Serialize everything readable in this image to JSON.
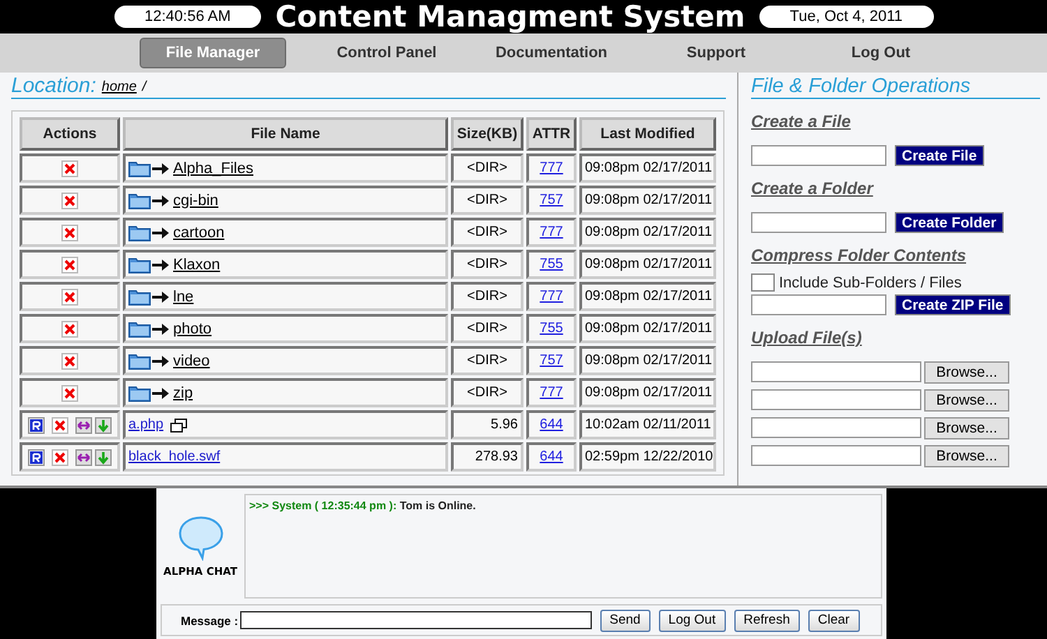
{
  "header": {
    "clock": "12:40:56 AM",
    "title": "Content Managment System",
    "date": "Tue, Oct 4, 2011"
  },
  "nav": [
    {
      "label": "File Manager",
      "selected": true
    },
    {
      "label": "Control Panel",
      "selected": false
    },
    {
      "label": "Documentation",
      "selected": false
    },
    {
      "label": "Support",
      "selected": false
    },
    {
      "label": "Log Out",
      "selected": false
    }
  ],
  "location": {
    "label": "Location:",
    "path": "home",
    "separator": "/"
  },
  "table": {
    "columns": [
      "Actions",
      "File Name",
      "Size(KB)",
      "ATTR",
      "Last Modified"
    ],
    "rows": [
      {
        "kind": "dir",
        "name": "Alpha_Files",
        "size": "<DIR>",
        "attr": "777",
        "modified": "09:08pm 02/17/2011"
      },
      {
        "kind": "dir",
        "name": "cgi-bin",
        "size": "<DIR>",
        "attr": "757",
        "modified": "09:08pm 02/17/2011"
      },
      {
        "kind": "dir",
        "name": "cartoon",
        "size": "<DIR>",
        "attr": "777",
        "modified": "09:08pm 02/17/2011"
      },
      {
        "kind": "dir",
        "name": "Klaxon",
        "size": "<DIR>",
        "attr": "755",
        "modified": "09:08pm 02/17/2011"
      },
      {
        "kind": "dir",
        "name": "lne",
        "size": "<DIR>",
        "attr": "777",
        "modified": "09:08pm 02/17/2011"
      },
      {
        "kind": "dir",
        "name": "photo",
        "size": "<DIR>",
        "attr": "755",
        "modified": "09:08pm 02/17/2011"
      },
      {
        "kind": "dir",
        "name": "video",
        "size": "<DIR>",
        "attr": "757",
        "modified": "09:08pm 02/17/2011"
      },
      {
        "kind": "dir",
        "name": "zip",
        "size": "<DIR>",
        "attr": "777",
        "modified": "09:08pm 02/17/2011"
      },
      {
        "kind": "file",
        "name": "a.php",
        "popup": true,
        "size": "5.96",
        "attr": "644",
        "modified": "10:02am 02/11/2011"
      },
      {
        "kind": "file",
        "name": "black_hole.swf",
        "popup": false,
        "size": "278.93",
        "attr": "644",
        "modified": "02:59pm 12/22/2010"
      }
    ]
  },
  "operations": {
    "title": "File & Folder Operations",
    "create_file": {
      "heading": "Create a File",
      "button": "Create File"
    },
    "create_folder": {
      "heading": "Create a Folder",
      "button": "Create Folder"
    },
    "compress": {
      "heading": "Compress Folder Contents",
      "checkbox_label": "Include Sub-Folders / Files",
      "checked": false,
      "button": "Create ZIP File"
    },
    "upload": {
      "heading": "Upload File(s)",
      "browse_buttons": [
        "Browse...",
        "Browse...",
        "Browse...",
        "Browse..."
      ]
    }
  },
  "chat": {
    "logo": "ALPHA CHAT",
    "messages": [
      {
        "prefix": ">>> System ( 12:35:44 pm ):",
        "text": "Tom is Online."
      }
    ],
    "message_label": "Message :",
    "buttons": [
      "Send",
      "Log Out",
      "Refresh",
      "Clear"
    ]
  }
}
